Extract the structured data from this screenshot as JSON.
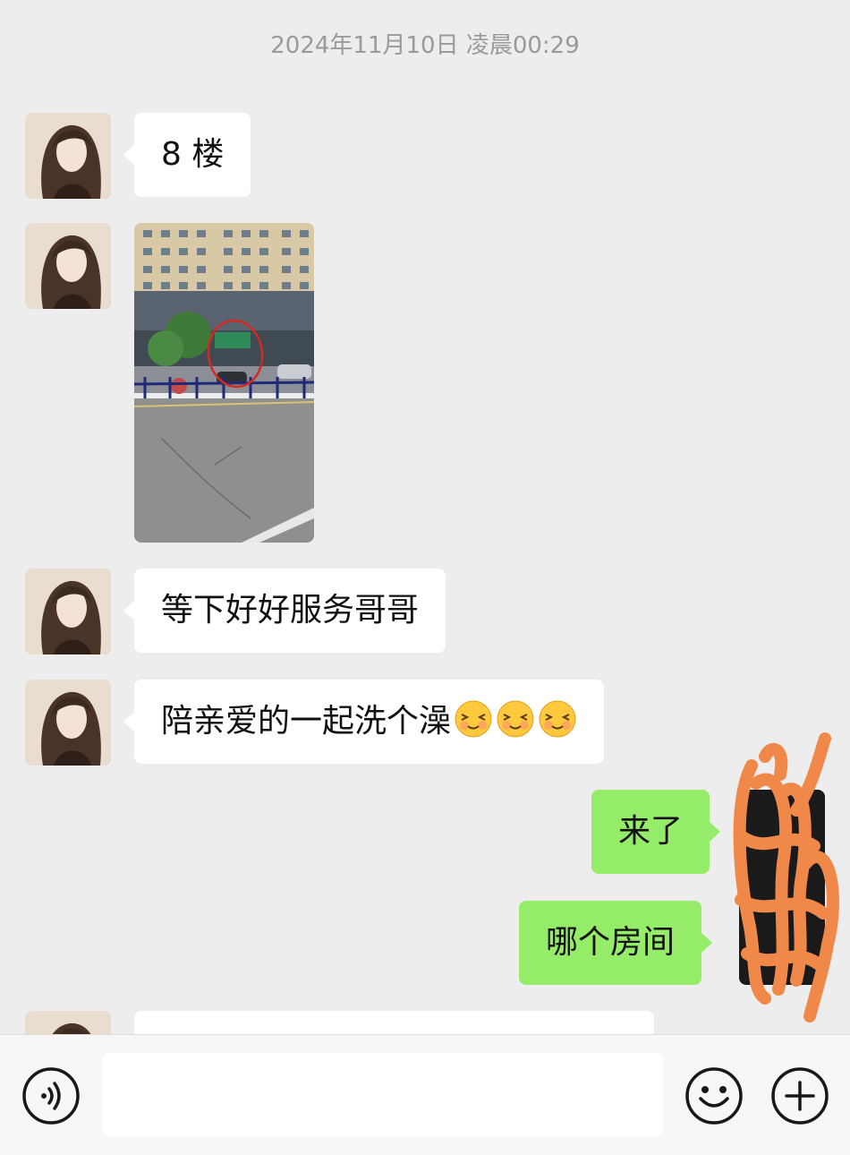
{
  "chat": {
    "timestamp": "2024年11月10日 凌晨00:29",
    "messages": [
      {
        "direction": "incoming",
        "type": "text",
        "text": "8 楼"
      },
      {
        "direction": "incoming",
        "type": "image",
        "image_desc": "street-photo-building-circled"
      },
      {
        "direction": "incoming",
        "type": "text",
        "text": "等下好好服务哥哥"
      },
      {
        "direction": "incoming",
        "type": "text",
        "text": "陪亲爱的一起洗个澡",
        "emoji": [
          "smiling-face-with-closed-eyes",
          "smiling-face-with-closed-eyes",
          "smiling-face-with-closed-eyes"
        ]
      },
      {
        "direction": "outgoing",
        "type": "text",
        "text": "来了"
      },
      {
        "direction": "outgoing",
        "type": "text",
        "text": "哪个房间"
      },
      {
        "direction": "incoming",
        "type": "text",
        "text": ""
      }
    ]
  },
  "input_bar": {
    "voice_icon": "voice-icon",
    "emoji_icon": "emoji-icon",
    "add_icon": "add-icon",
    "input_value": ""
  },
  "colors": {
    "background": "#ededed",
    "incoming_bubble": "#ffffff",
    "outgoing_bubble": "#95ec69",
    "timestamp": "#9a9a9a",
    "redaction_scribble": "#f0884a"
  }
}
